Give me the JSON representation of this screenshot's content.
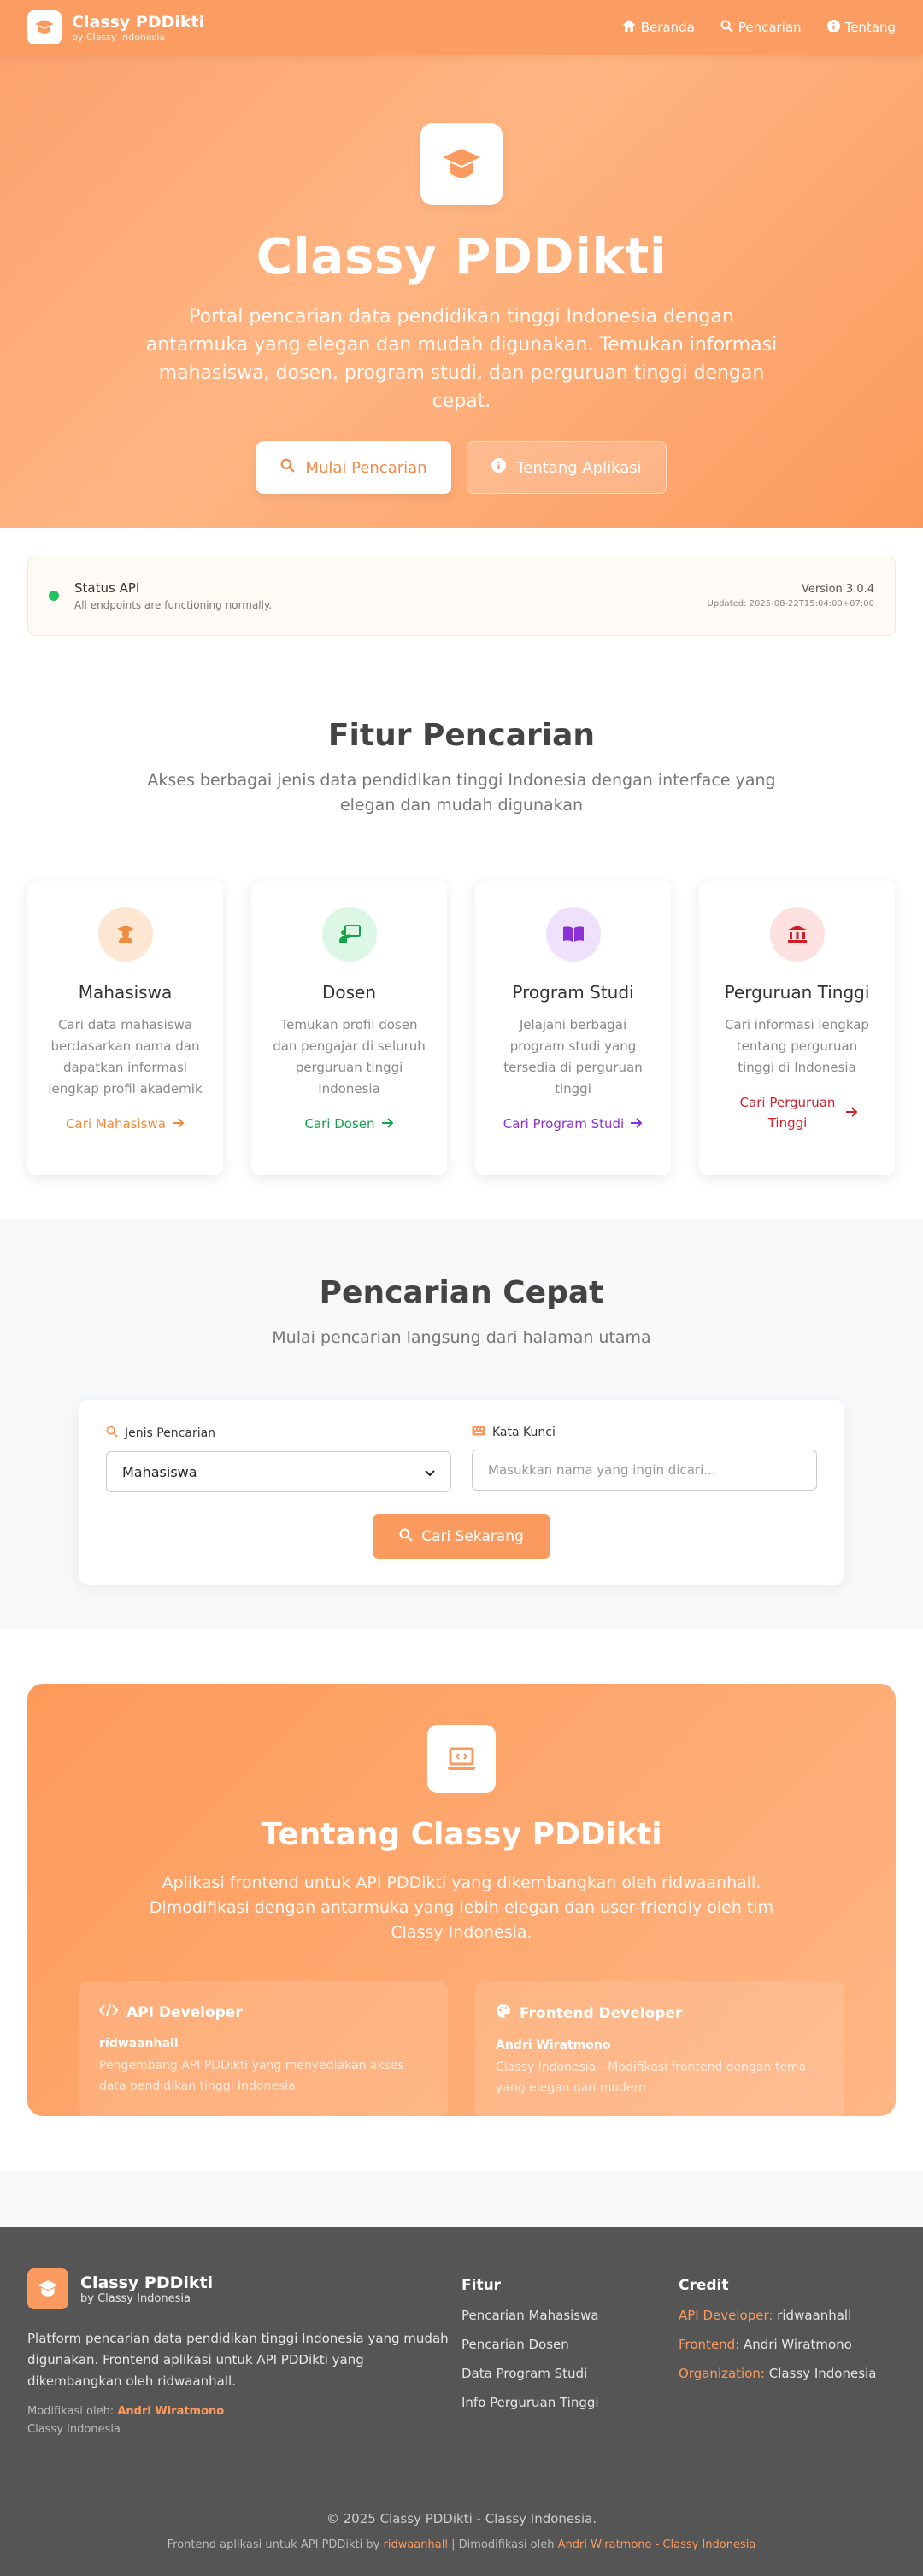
{
  "nav": {
    "title": "Classy PDDikti",
    "subtitle": "by Classy Indonesia",
    "links": [
      "Beranda",
      "Pencarian",
      "Tentang"
    ]
  },
  "hero": {
    "title": "Classy PDDikti",
    "description": "Portal pencarian data pendidikan tinggi Indonesia dengan antarmuka yang elegan dan mudah digunakan. Temukan informasi mahasiswa, dosen, program studi, dan perguruan tinggi dengan cepat.",
    "primary_button": "Mulai Pencarian",
    "secondary_button": "Tentang Aplikasi"
  },
  "status": {
    "title": "Status API",
    "message": "All endpoints are functioning normally.",
    "version": "Version 3.0.4",
    "updated": "Updated: 2025-08-22T15:04:00+07:00"
  },
  "features": {
    "title": "Fitur Pencarian",
    "description": "Akses berbagai jenis data pendidikan tinggi Indonesia dengan interface yang elegan dan mudah digunakan",
    "cards": [
      {
        "title": "Mahasiswa",
        "desc": "Cari data mahasiswa berdasarkan nama dan dapatkan informasi lengkap profil akademik",
        "link": "Cari Mahasiswa",
        "color": "#f08a3c",
        "bg": "#fde7d3"
      },
      {
        "title": "Dosen",
        "desc": "Temukan profil dosen dan pengajar di seluruh perguruan tinggi Indonesia",
        "link": "Cari Dosen",
        "color": "#15a34a",
        "bg": "#dcf7e5"
      },
      {
        "title": "Program Studi",
        "desc": "Jelajahi berbagai program studi yang tersedia di perguruan tinggi",
        "link": "Cari Program Studi",
        "color": "#8b2fd9",
        "bg": "#efe1fb"
      },
      {
        "title": "Perguruan Tinggi",
        "desc": "Cari informasi lengkap tentang perguruan tinggi di Indonesia",
        "link": "Cari Perguruan Tinggi",
        "color": "#d11f2a",
        "bg": "#fde0e0"
      }
    ]
  },
  "quick": {
    "title": "Pencarian Cepat",
    "description": "Mulai pencarian langsung dari halaman utama",
    "type_label": "Jenis Pencarian",
    "type_value": "Mahasiswa",
    "keyword_label": "Kata Kunci",
    "keyword_placeholder": "Masukkan nama yang ingin dicari...",
    "button": "Cari Sekarang"
  },
  "about": {
    "title": "Tentang Classy PDDikti",
    "description": "Aplikasi frontend untuk API PDDikti yang dikembangkan oleh ridwaanhall. Dimodifikasi dengan antarmuka yang lebih elegan dan user-friendly oleh tim Classy Indonesia.",
    "api_title": "API Developer",
    "api_name": "ridwaanhall",
    "api_desc": "Pengembang API PDDikti yang menyediakan akses data pendidikan tinggi Indonesia",
    "fe_title": "Frontend Developer",
    "fe_name": "Andri Wiratmono",
    "fe_desc": "Classy Indonesia - Modifikasi frontend dengan tema yang elegan dan modern"
  },
  "footer": {
    "title": "Classy PDDikti",
    "subtitle": "by Classy Indonesia",
    "description": "Platform pencarian data pendidikan tinggi Indonesia yang mudah digunakan. Frontend aplikasi untuk API PDDikti yang dikembangkan oleh ridwaanhall.",
    "mod_label": "Modifikasi oleh:",
    "mod_name": "Andri Wiratmono",
    "mod_org": "Classy Indonesia",
    "features_head": "Fitur",
    "features_links": [
      "Pencarian Mahasiswa",
      "Pencarian Dosen",
      "Data Program Studi",
      "Info Perguruan Tinggi"
    ],
    "credit_head": "Credit",
    "credit_api_label": "API Developer:",
    "credit_api_value": "ridwaanhall",
    "credit_fe_label": "Frontend:",
    "credit_fe_value": "Andri Wiratmono",
    "credit_org_label": "Organization:",
    "credit_org_value": "Classy Indonesia",
    "copyright": "© 2025 Classy PDDikti - Classy Indonesia.",
    "note_prefix": "Frontend aplikasi untuk API PDDikti by",
    "note_api": "ridwaanhall",
    "note_mid": "| Dimodifikasi oleh",
    "note_fe": "Andri Wiratmono - Classy Indonesia"
  },
  "colors": {
    "accent": "#fb9a5e",
    "footer_bg": "#555555",
    "status_ok": "#22c55e"
  }
}
